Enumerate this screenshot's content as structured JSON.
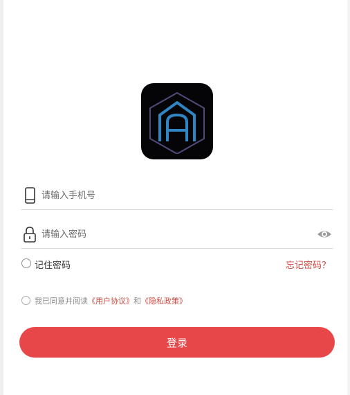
{
  "login": {
    "phone_placeholder": "请输入手机号",
    "password_placeholder": "请输入密码",
    "remember_label": "记住密码",
    "forgot_label": "忘记密码？",
    "agree_prefix": "我已同意并阅读",
    "user_agreement": "《用户协议》",
    "agree_and": "和",
    "privacy_policy": "《隐私政策》",
    "submit_label": "登录"
  },
  "icons": {
    "logo": "app-logo-house-a",
    "phone": "phone-icon",
    "lock": "lock-icon",
    "eye": "eye-icon"
  },
  "colors": {
    "accent": "#e8474a",
    "link": "#cf4a40",
    "logo_bg": "#050507"
  }
}
